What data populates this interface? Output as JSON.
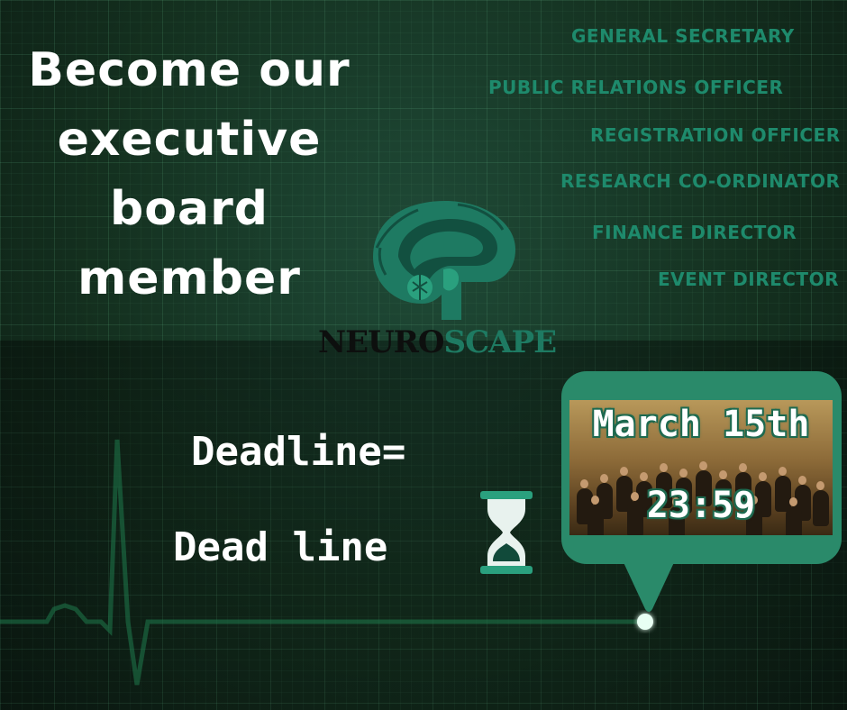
{
  "headline": [
    "Become our",
    "executive",
    "board",
    "member"
  ],
  "roles": [
    "GENERAL SECRETARY",
    "PUBLIC RELATIONS OFFICER",
    "REGISTRATION OFFICER",
    "RESEARCH CO-ORDINATOR",
    "FINANCE DIRECTOR",
    "EVENT DIRECTOR"
  ],
  "logo": {
    "part1": "NEURO",
    "part2": "SCAPE"
  },
  "deadline": {
    "line1": "Deadline=",
    "line2": "Dead line"
  },
  "bubble": {
    "date": "March 15th",
    "time": "23:59"
  },
  "icons": [
    "brain-logo-icon",
    "hourglass-icon"
  ],
  "colors": {
    "accent": "#1e8a6c",
    "bubble": "#2a8a6a",
    "ecg": "#3dffa8",
    "background": "#14301f"
  }
}
